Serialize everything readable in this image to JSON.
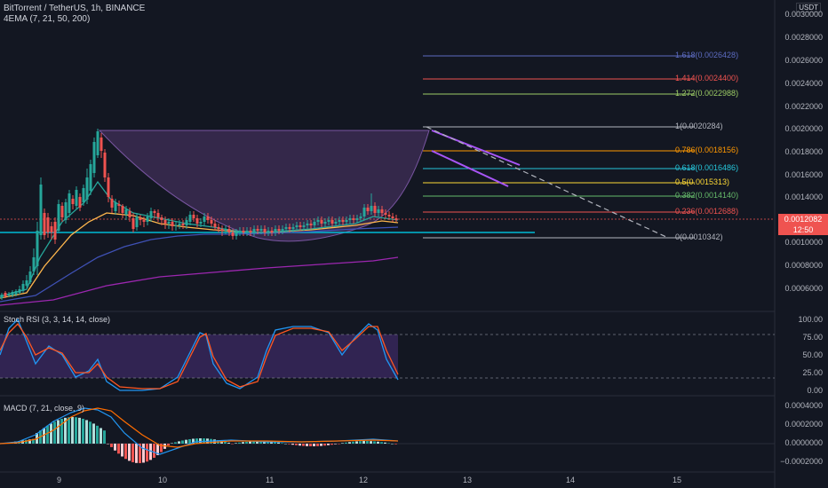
{
  "header": {
    "title": "BitTorrent / TetherUS, 1h, BINANCE",
    "indicator": "4EMA (7, 21, 50, 200)",
    "currency": "USDT"
  },
  "price_axis": {
    "ticks": [
      "0.0030000",
      "0.0028000",
      "0.0026000",
      "0.0024000",
      "0.0022000",
      "0.0020000",
      "0.0018000",
      "0.0016000",
      "0.0014000",
      "0.0012000",
      "0.0010000",
      "0.0008000",
      "0.0006000"
    ],
    "current_price": "0.0012082",
    "countdown": "12:50"
  },
  "rsi_pane": {
    "title": "Stoch RSI (3, 3, 14, 14, close)",
    "ticks": [
      "100.00",
      "75.00",
      "50.00",
      "25.00",
      "0.00"
    ]
  },
  "macd_pane": {
    "title": "MACD (7, 21, close, 9)",
    "ticks": [
      "0.0004000",
      "0.0002000",
      "0.0000000",
      "−0.0002000"
    ]
  },
  "time_axis": {
    "ticks": [
      "9",
      "10",
      "11",
      "12",
      "13",
      "14",
      "15"
    ]
  },
  "fib_levels": [
    {
      "label": "1.618(0.0026428)",
      "color": "#5c6bc0"
    },
    {
      "label": "1.414(0.0024400)",
      "color": "#ef5350"
    },
    {
      "label": "1.272(0.0022988)",
      "color": "#9ccc65"
    },
    {
      "label": "1(0.0020284)",
      "color": "#b2b5be"
    },
    {
      "label": "0.786(0.0018156)",
      "color": "#ff9800"
    },
    {
      "label": "0.618(0.0016486)",
      "color": "#26c6da"
    },
    {
      "label": "0.5(0.0015313)",
      "color": "#fdd835"
    },
    {
      "label": "0.382(0.0014140)",
      "color": "#66bb6a"
    },
    {
      "label": "0.236(0.0012688)",
      "color": "#ef5350"
    },
    {
      "label": "0(0.0010342)",
      "color": "#b2b5be"
    }
  ],
  "colors": {
    "background": "#131722",
    "up": "#26a69a",
    "down": "#ef5350",
    "ema7": "#ef5350",
    "ema21": "#26a69a",
    "ema50": "#ffb74d",
    "ema200": "#9c27b0",
    "ema100": "#3f51b5",
    "cup_fill": "#7b4fa0",
    "rsi_band": "#4a2f7a",
    "k_line": "#2196f3",
    "d_line": "#ff5722"
  },
  "chart_data": {
    "type": "line",
    "title": "BitTorrent / TetherUS, 1h, BINANCE",
    "x_categories": [
      "9",
      "10",
      "11",
      "12",
      "13",
      "14",
      "15"
    ],
    "price_range": [
      0.00045,
      0.003
    ],
    "close_approx": [
      {
        "x": "8.5",
        "y": 0.00065
      },
      {
        "x": "8.9",
        "y": 0.0008
      },
      {
        "x": "9.0",
        "y": 0.00125
      },
      {
        "x": "9.3",
        "y": 0.00195
      },
      {
        "x": "9.5",
        "y": 0.00135
      },
      {
        "x": "9.8",
        "y": 0.00125
      },
      {
        "x": "10.2",
        "y": 0.00117
      },
      {
        "x": "10.7",
        "y": 0.00112
      },
      {
        "x": "11.0",
        "y": 0.0011
      },
      {
        "x": "11.5",
        "y": 0.00113
      },
      {
        "x": "12.0",
        "y": 0.0013
      },
      {
        "x": "12.3",
        "y": 0.00121
      }
    ],
    "stoch_rsi_range": [
      0,
      100
    ],
    "macd_range": [
      -0.0003,
      0.0005
    ]
  }
}
